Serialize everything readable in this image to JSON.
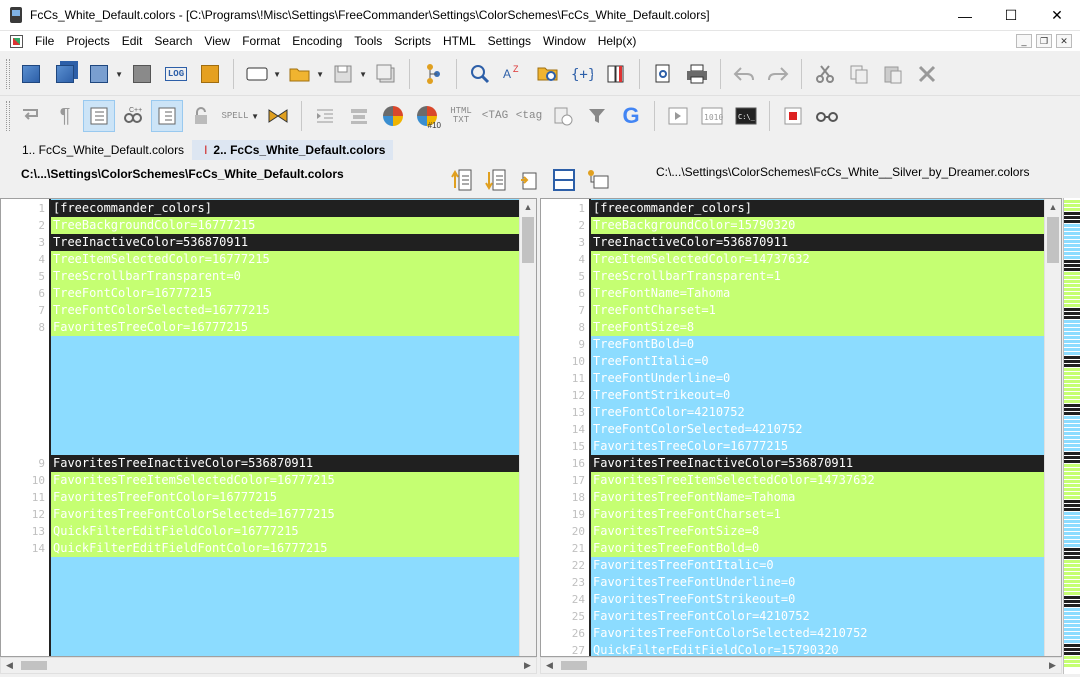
{
  "window": {
    "title": "FcCs_White_Default.colors - [C:\\Programs\\!Misc\\Settings\\FreeCommander\\Settings\\ColorSchemes\\FcCs_White_Default.colors]",
    "minimize": "—",
    "maximize": "☐",
    "close": "✕"
  },
  "menu": {
    "items": [
      "File",
      "Projects",
      "Edit",
      "Search",
      "View",
      "Format",
      "Encoding",
      "Tools",
      "Scripts",
      "HTML",
      "Settings",
      "Window",
      "Help(x)"
    ],
    "mdi_min": "_",
    "mdi_restore": "❐",
    "mdi_close": "✕"
  },
  "toolbar1": {
    "log_label": "LOG"
  },
  "toolbar2": {
    "spell_label": "SPELL",
    "html_txt_top": "HTML",
    "html_txt_bottom": "TXT",
    "tag_label": "TAG",
    "tag_label_2": "tag",
    "google_label": "G",
    "number_badge": "#10"
  },
  "tabs": [
    {
      "label": "1.. FcCs_White_Default.colors",
      "active": false
    },
    {
      "label": "2.. FcCs_White_Default.colors",
      "active": true,
      "mark": "I"
    }
  ],
  "compare": {
    "left_path": "C:\\...\\Settings\\ColorSchemes\\FcCs_White_Default.colors",
    "right_path": "C:\\...\\Settings\\ColorSchemes\\FcCs_White__Silver_by_Dreamer.colors"
  },
  "left_pane": {
    "lines": [
      {
        "num": "1",
        "text": "[freecommander_colors]",
        "kind": "equal"
      },
      {
        "num": "2",
        "text": "TreeBackgroundColor=16777215",
        "kind": "changed"
      },
      {
        "num": "3",
        "text": "TreeInactiveColor=536870911",
        "kind": "equal"
      },
      {
        "num": "4",
        "text": "TreeItemSelectedColor=16777215",
        "kind": "changed"
      },
      {
        "num": "5",
        "text": "TreeScrollbarTransparent=0",
        "kind": "changed"
      },
      {
        "num": "6",
        "text": "TreeFontColor=16777215",
        "kind": "changed"
      },
      {
        "num": "7",
        "text": "TreeFontColorSelected=16777215",
        "kind": "changed"
      },
      {
        "num": "8",
        "text": "FavoritesTreeColor=16777215",
        "kind": "changed"
      },
      {
        "num": "9",
        "text": "FavoritesTreeInactiveColor=536870911",
        "kind": "equal"
      },
      {
        "num": "10",
        "text": "FavoritesTreeItemSelectedColor=16777215",
        "kind": "changed"
      },
      {
        "num": "11",
        "text": "FavoritesTreeFontColor=16777215",
        "kind": "changed"
      },
      {
        "num": "12",
        "text": "FavoritesTreeFontColorSelected=16777215",
        "kind": "changed"
      },
      {
        "num": "13",
        "text": "QuickFilterEditFieldColor=16777215",
        "kind": "changed"
      },
      {
        "num": "14",
        "text": "QuickFilterEditFieldFontColor=16777215",
        "kind": "changed"
      }
    ]
  },
  "right_pane": {
    "lines": [
      {
        "num": "1",
        "text": "[freecommander_colors]",
        "kind": "equal"
      },
      {
        "num": "2",
        "text": "TreeBackgroundColor=15790320",
        "kind": "changed"
      },
      {
        "num": "3",
        "text": "TreeInactiveColor=536870911",
        "kind": "equal"
      },
      {
        "num": "4",
        "text": "TreeItemSelectedColor=14737632",
        "kind": "changed"
      },
      {
        "num": "5",
        "text": "TreeScrollbarTransparent=1",
        "kind": "changed"
      },
      {
        "num": "6",
        "text": "TreeFontName=Tahoma",
        "kind": "changed"
      },
      {
        "num": "7",
        "text": "TreeFontCharset=1",
        "kind": "changed"
      },
      {
        "num": "8",
        "text": "TreeFontSize=8",
        "kind": "changed"
      },
      {
        "num": "9",
        "text": "TreeFontBold=0",
        "kind": "added"
      },
      {
        "num": "10",
        "text": "TreeFontItalic=0",
        "kind": "added"
      },
      {
        "num": "11",
        "text": "TreeFontUnderline=0",
        "kind": "added"
      },
      {
        "num": "12",
        "text": "TreeFontStrikeout=0",
        "kind": "added"
      },
      {
        "num": "13",
        "text": "TreeFontColor=4210752",
        "kind": "added"
      },
      {
        "num": "14",
        "text": "TreeFontColorSelected=4210752",
        "kind": "added"
      },
      {
        "num": "15",
        "text": "FavoritesTreeColor=16777215",
        "kind": "added"
      },
      {
        "num": "16",
        "text": "FavoritesTreeInactiveColor=536870911",
        "kind": "equal"
      },
      {
        "num": "17",
        "text": "FavoritesTreeItemSelectedColor=14737632",
        "kind": "changed"
      },
      {
        "num": "18",
        "text": "FavoritesTreeFontName=Tahoma",
        "kind": "changed"
      },
      {
        "num": "19",
        "text": "FavoritesTreeFontCharset=1",
        "kind": "changed"
      },
      {
        "num": "20",
        "text": "FavoritesTreeFontSize=8",
        "kind": "changed"
      },
      {
        "num": "21",
        "text": "FavoritesTreeFontBold=0",
        "kind": "changed"
      },
      {
        "num": "22",
        "text": "FavoritesTreeFontItalic=0",
        "kind": "added"
      },
      {
        "num": "23",
        "text": "FavoritesTreeFontUnderline=0",
        "kind": "added"
      },
      {
        "num": "24",
        "text": "FavoritesTreeFontStrikeout=0",
        "kind": "added"
      },
      {
        "num": "25",
        "text": "FavoritesTreeFontColor=4210752",
        "kind": "added"
      },
      {
        "num": "26",
        "text": "FavoritesTreeFontColorSelected=4210752",
        "kind": "added"
      },
      {
        "num": "27",
        "text": "QuickFilterEditFieldColor=15790320",
        "kind": "added"
      }
    ]
  },
  "colors": {
    "equal_bg": "#202020",
    "changed_bg": "#c5ff72",
    "added_bg": "#8cdcff"
  }
}
